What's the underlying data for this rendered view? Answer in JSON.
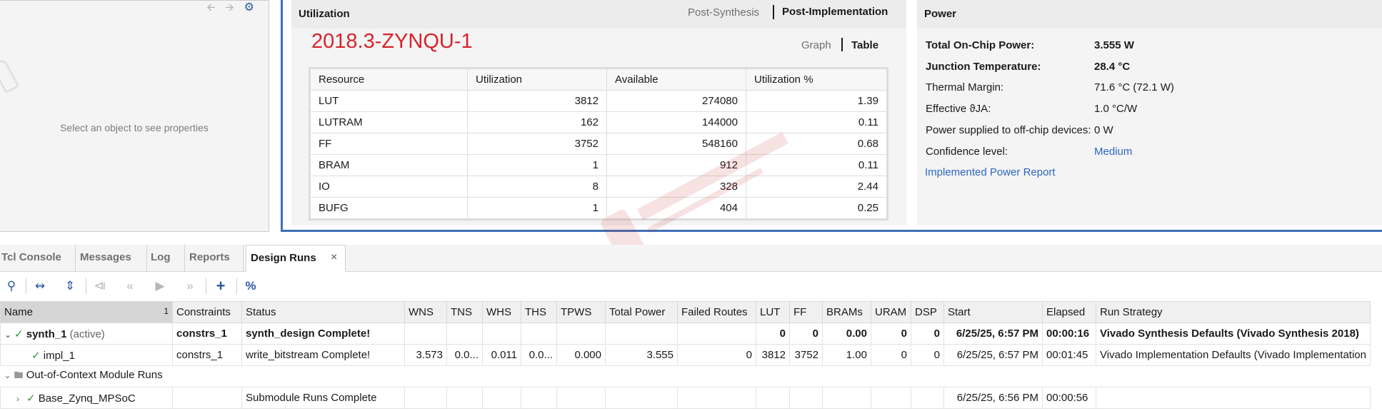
{
  "properties": {
    "empty_message": "Select an object to see properties",
    "toolbar": {
      "back_icon": "arrow-left-icon",
      "forward_icon": "arrow-right-icon",
      "settings_icon": "gear-icon"
    }
  },
  "utilization": {
    "title": "Utilization",
    "tabs": [
      "Post-Synthesis",
      "Post-Implementation"
    ],
    "active_tab": "Post-Implementation",
    "part_name": "2018.3-ZYNQU-1",
    "view_options": [
      "Graph",
      "Table"
    ],
    "active_view": "Table",
    "columns": [
      "Resource",
      "Utilization",
      "Available",
      "Utilization %"
    ],
    "rows": [
      {
        "resource": "LUT",
        "utilization": "3812",
        "available": "274080",
        "percent": "1.39"
      },
      {
        "resource": "LUTRAM",
        "utilization": "162",
        "available": "144000",
        "percent": "0.11"
      },
      {
        "resource": "FF",
        "utilization": "3752",
        "available": "548160",
        "percent": "0.68"
      },
      {
        "resource": "BRAM",
        "utilization": "1",
        "available": "912",
        "percent": "0.11"
      },
      {
        "resource": "IO",
        "utilization": "8",
        "available": "328",
        "percent": "2.44"
      },
      {
        "resource": "BUFG",
        "utilization": "1",
        "available": "404",
        "percent": "0.25"
      }
    ]
  },
  "power": {
    "title": "Power",
    "rows": [
      {
        "label": "Total On-Chip Power:",
        "value": "3.555 W"
      },
      {
        "label": "Junction Temperature:",
        "value": "28.4 °C"
      },
      {
        "label": "Thermal Margin:",
        "value": "71.6 °C (72.1 W)"
      },
      {
        "label": "Effective ϑJA:",
        "value": "1.0 °C/W"
      },
      {
        "label": "Power supplied to off-chip devices:",
        "value": "0 W"
      },
      {
        "label": "Confidence level:",
        "value": "Medium"
      }
    ],
    "report_link": "Implemented Power Report"
  },
  "bottom_tabs": {
    "tabs": [
      "Tcl Console",
      "Messages",
      "Log",
      "Reports",
      "Design Runs"
    ],
    "active": "Design Runs",
    "close_glyph": "×"
  },
  "toolbar_icons": [
    "search-icon",
    "collapse-all-icon",
    "expand-all-icon",
    "first-icon",
    "previous-icon",
    "run-icon",
    "next-icon",
    "add-icon",
    "percent-icon"
  ],
  "design_runs": {
    "sort_indicator": "1",
    "columns": [
      "Name",
      "Constraints",
      "Status",
      "WNS",
      "TNS",
      "WHS",
      "THS",
      "TPWS",
      "Total Power",
      "Failed Routes",
      "LUT",
      "FF",
      "BRAMs",
      "URAM",
      "DSP",
      "Start",
      "Elapsed",
      "Run Strategy"
    ],
    "rows": [
      {
        "name": "synth_1",
        "suffix": "(active)",
        "constraints": "constrs_1",
        "status": "synth_design Complete!",
        "wns": "",
        "tns": "",
        "whs": "",
        "ths": "",
        "tpws": "",
        "total_power": "",
        "failed_routes": "",
        "lut": "0",
        "ff": "0",
        "brams": "0.00",
        "uram": "0",
        "dsp": "0",
        "start": "6/25/25, 6:57 PM",
        "elapsed": "00:00:16",
        "strategy": "Vivado Synthesis Defaults (Vivado Synthesis 2018)"
      },
      {
        "name": "impl_1",
        "suffix": "",
        "constraints": "constrs_1",
        "status": "write_bitstream Complete!",
        "wns": "3.573",
        "tns": "0.0...",
        "whs": "0.011",
        "ths": "0.0...",
        "tpws": "0.000",
        "total_power": "3.555",
        "failed_routes": "0",
        "lut": "3812",
        "ff": "3752",
        "brams": "1.00",
        "uram": "0",
        "dsp": "0",
        "start": "6/25/25, 6:57 PM",
        "elapsed": "00:01:45",
        "strategy": "Vivado Implementation Defaults (Vivado Implementation"
      },
      {
        "name": "Out-of-Context Module Runs"
      },
      {
        "name": "Base_Zynq_MPSoC",
        "status": "Submodule Runs Complete",
        "start": "6/25/25, 6:56 PM",
        "elapsed": "00:00:56"
      }
    ]
  }
}
